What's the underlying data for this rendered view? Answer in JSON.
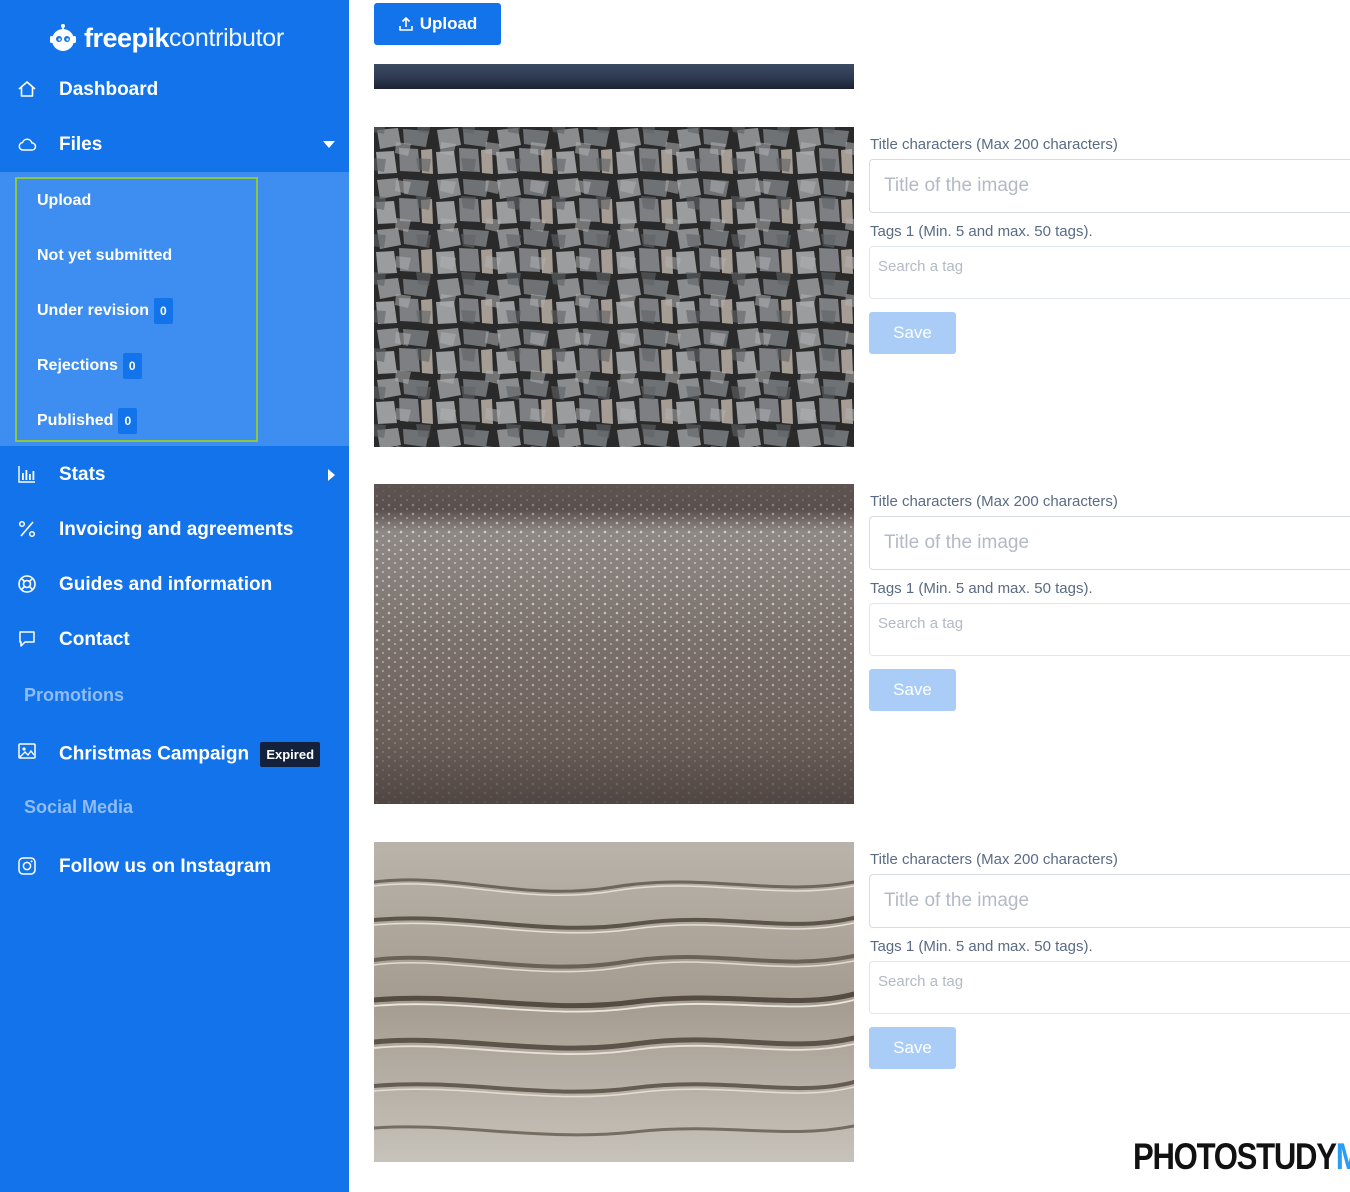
{
  "brand": {
    "name_bold": "freepik",
    "name_light": "contributor"
  },
  "sidebar": {
    "nav": [
      {
        "label": "Dashboard",
        "icon": "home-icon"
      },
      {
        "label": "Files",
        "icon": "cloud-icon"
      },
      {
        "label": "Stats",
        "icon": "bar-chart-icon"
      },
      {
        "label": "Invoicing and agreements",
        "icon": "percent-icon"
      },
      {
        "label": "Guides and information",
        "icon": "lifebuoy-icon"
      },
      {
        "label": "Contact",
        "icon": "chat-icon"
      }
    ],
    "files_submenu": [
      {
        "label": "Upload"
      },
      {
        "label": "Not yet submitted"
      },
      {
        "label": "Under revision",
        "count": "0"
      },
      {
        "label": "Rejections",
        "count": "0"
      },
      {
        "label": "Published",
        "count": "0"
      }
    ],
    "promotions": {
      "heading": "Promotions",
      "item": {
        "label": "Christmas Campaign",
        "badge": "Expired",
        "icon": "image-icon"
      }
    },
    "social": {
      "heading": "Social Media",
      "item": {
        "label": "Follow us on Instagram",
        "icon": "instagram-icon"
      }
    }
  },
  "main": {
    "upload_label": "Upload",
    "cards": [
      {
        "image": "stone-wall",
        "title_label": "Title characters (Max 200 characters)",
        "title_placeholder": "Title of the image",
        "tags_label": "Tags 1 (Min. 5 and max. 50 tags).",
        "tags_placeholder": "Search a tag",
        "save_label": "Save"
      },
      {
        "image": "water-droplets",
        "title_label": "Title characters (Max 200 characters)",
        "title_placeholder": "Title of the image",
        "tags_label": "Tags 1 (Min. 5 and max. 50 tags).",
        "tags_placeholder": "Search a tag",
        "save_label": "Save"
      },
      {
        "image": "sand-ripples",
        "title_label": "Title characters (Max 200 characters)",
        "title_placeholder": "Title of the image",
        "tags_label": "Tags 1 (Min. 5 and max. 50 tags).",
        "tags_placeholder": "Search a tag",
        "save_label": "Save"
      }
    ]
  },
  "watermark": {
    "part_a": "PHOTOSTUDY",
    "part_b": "ME"
  },
  "colors": {
    "sidebar": "#1273eb",
    "submenu": "#3d8ef0",
    "highlight": "#8ec63f",
    "save_disabled": "#a9cdf7",
    "expired_badge": "#14213d"
  }
}
